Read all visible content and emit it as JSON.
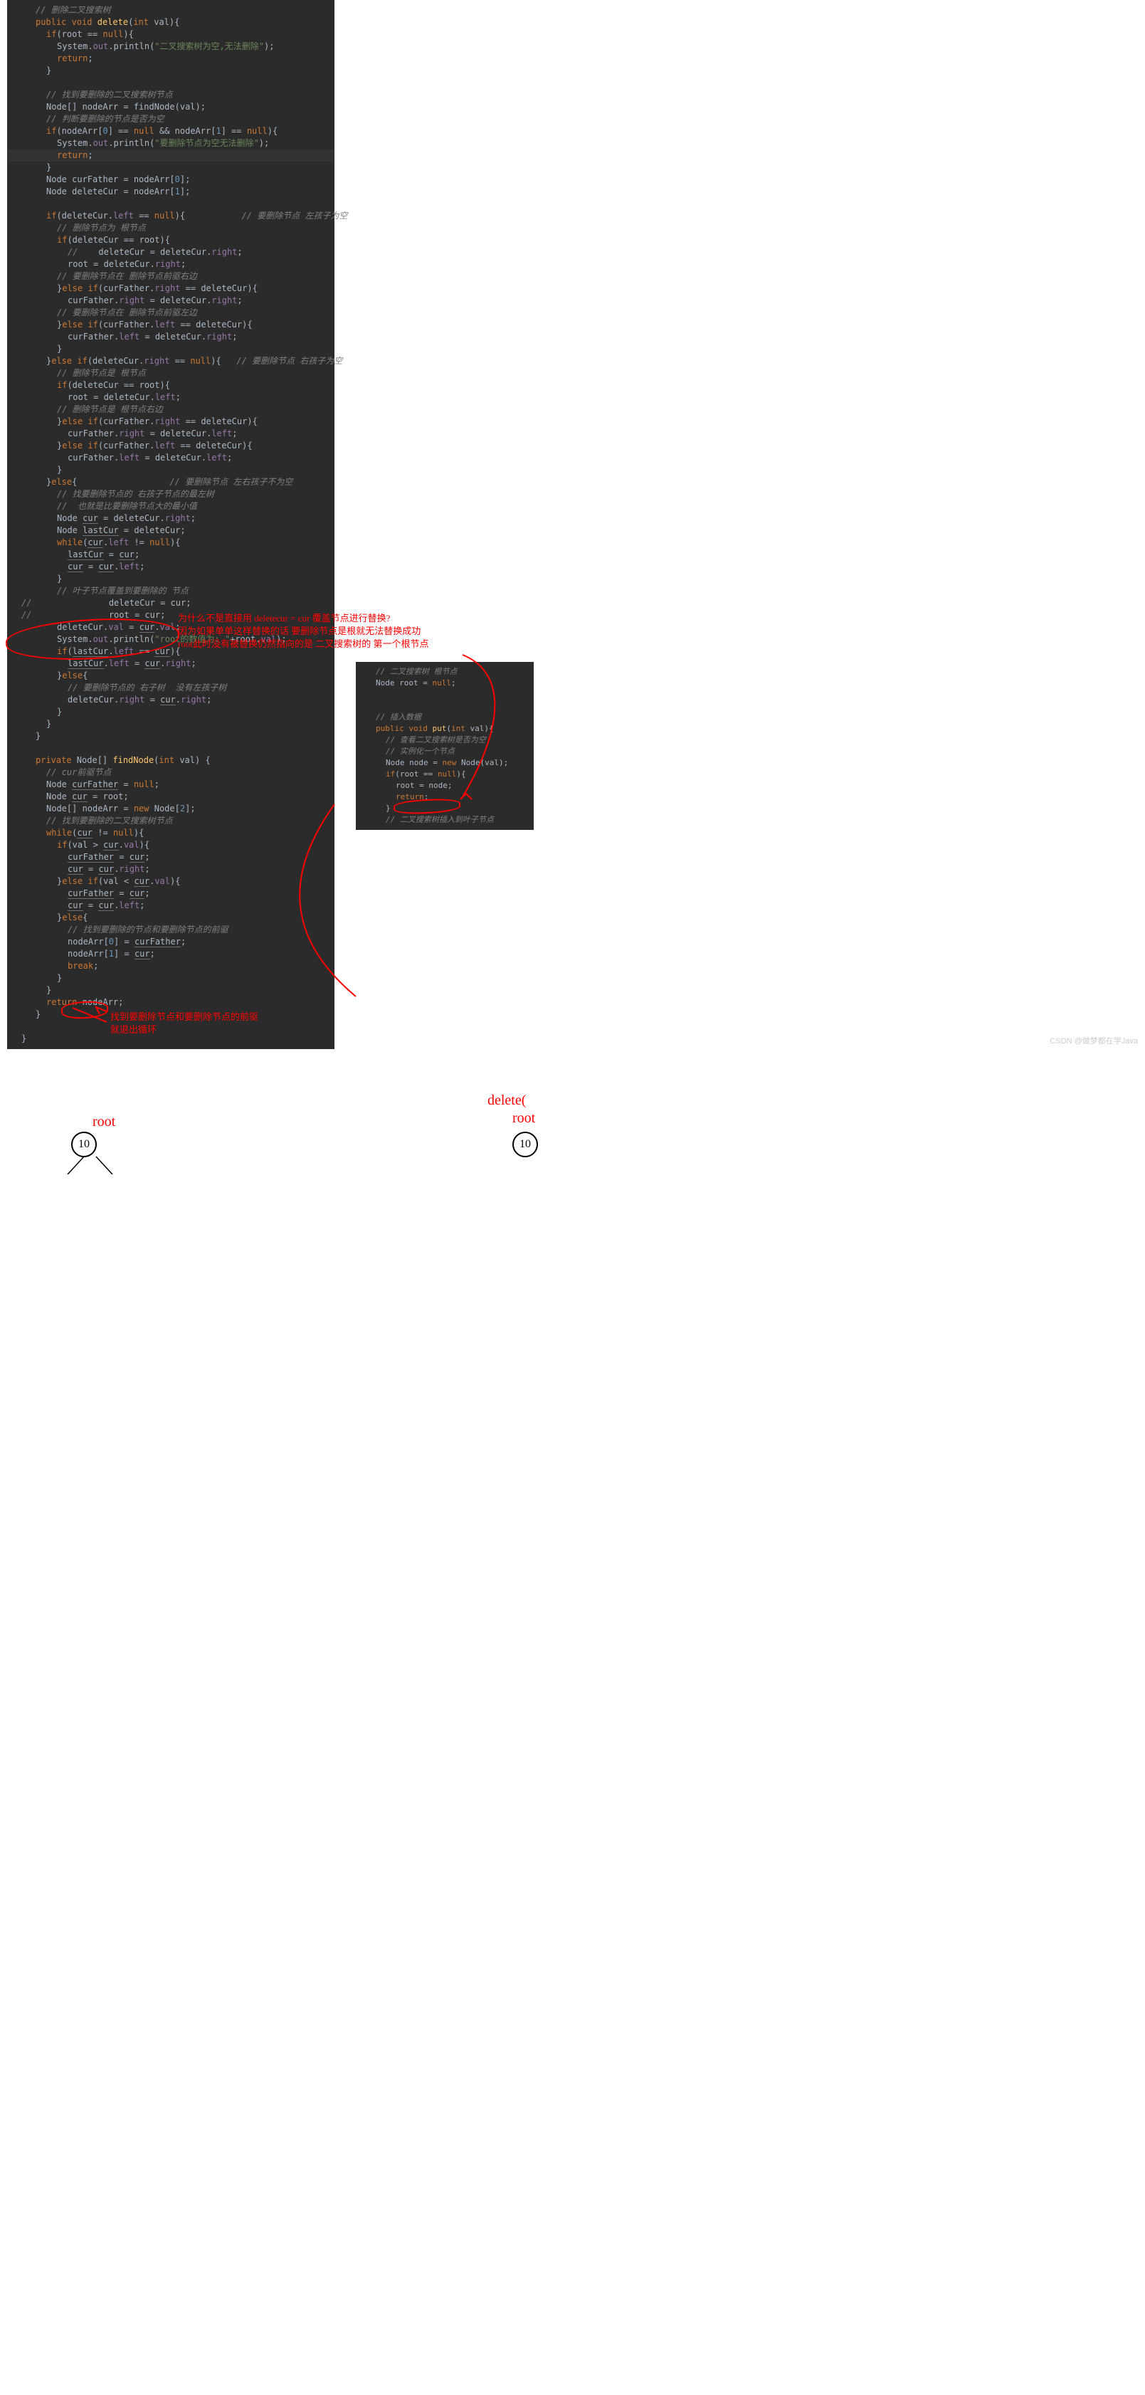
{
  "main": {
    "c0": "// 删除二叉搜索树",
    "l1a": "public void",
    "l1b": "delete",
    "l1c": "(",
    "l1d": "int",
    "l1e": " val){",
    "l2a": "if",
    "l2b": "(root == ",
    "l2c": "null",
    "l2d": "){",
    "l3a": "System.",
    "l3b": "out",
    "l3c": ".println(",
    "l3d": "\"二叉搜索树为空,无法删除\"",
    "l3e": ");",
    "l4a": "return",
    "l4b": ";",
    "l5": "}",
    "blank": "",
    "c1": "// 找到要删除的二叉搜索树节点",
    "l6a": "Node[] nodeArr = findNode(val);",
    "c2": "// 判断要删除的节点是否为空",
    "l7a": "if",
    "l7b": "(nodeArr[",
    "l7c": "0",
    "l7d": "] == ",
    "l7e": "null",
    "l7f": " && nodeArr[",
    "l7g": "1",
    "l7h": "] == ",
    "l7i": "null",
    "l7j": "){",
    "l8a": "System.",
    "l8b": "out",
    "l8c": ".println(",
    "l8d": "\"要删除节点为空无法删除\"",
    "l8e": ");",
    "l9a": "return",
    "l9b": ";",
    "l10": "}",
    "l11a": "Node curFather = nodeArr[",
    "l11b": "0",
    "l11c": "];",
    "l12a": "Node deleteCur = nodeArr[",
    "l12b": "1",
    "l12c": "];",
    "l13a": "if",
    "l13b": "(deleteCur.",
    "l13c": "left",
    "l13d": " == ",
    "l13e": "null",
    "l13f": "){",
    "l13g": "           // 要删除节点 左孩子为空",
    "c3": "// 删除节点为 根节点",
    "l14a": "if",
    "l14b": "(deleteCur == root){",
    "l15a": "    deleteCur = deleteCur.",
    "l15b": "right",
    "l15c": ";",
    "l16a": "root = deleteCur.",
    "l16b": "right",
    "l16c": ";",
    "c4": "// 要删除节点在 删除节点前驱右边",
    "l17a": "}",
    "l17b": "else if",
    "l17c": "(curFather.",
    "l17d": "right",
    "l17e": " == deleteCur){",
    "l18a": "curFather.",
    "l18b": "right",
    "l18c": " = deleteCur.",
    "l18d": "right",
    "l18e": ";",
    "c5": "// 要删除节点在 删除节点前驱左边",
    "l19a": "}",
    "l19b": "else if",
    "l19c": "(curFather.",
    "l19d": "left",
    "l19e": " == deleteCur){",
    "l20a": "curFather.",
    "l20b": "left",
    "l20c": " = deleteCur.",
    "l20d": "right",
    "l20e": ";",
    "l21": "}",
    "l22a": "}",
    "l22b": "else if",
    "l22c": "(deleteCur.",
    "l22d": "right",
    "l22e": " == ",
    "l22f": "null",
    "l22g": "){",
    "l22h": "   // 要删除节点 右孩子为空",
    "c6": "// 删除节点是 根节点",
    "l23a": "if",
    "l23b": "(deleteCur == root){",
    "l24a": "root = deleteCur.",
    "l24b": "left",
    "l24c": ";",
    "c7": "// 删除节点是 根节点右边",
    "l25a": "}",
    "l25b": "else if",
    "l25c": "(curFather.",
    "l25d": "right",
    "l25e": " == deleteCur){",
    "l26a": "curFather.",
    "l26b": "right",
    "l26c": " = deleteCur.",
    "l26d": "left",
    "l26e": ";",
    "l27a": "}",
    "l27b": "else if",
    "l27c": "(curFather.",
    "l27d": "left",
    "l27e": " == deleteCur){",
    "l28a": "curFather.",
    "l28b": "left",
    "l28c": " = deleteCur.",
    "l28d": "left",
    "l28e": ";",
    "l29": "}",
    "l30a": "}",
    "l30b": "else",
    "l30c": "{",
    "l30d": "                  // 要删除节点 左右孩子不为空",
    "c8": "// 找要删除节点的 右孩子节点的最左树",
    "c9": "//  也就是比要删除节点大的最小值",
    "l31a": "Node ",
    "l31b": "cur",
    "l31c": " = deleteCur.",
    "l31d": "right",
    "l31e": ";",
    "l32a": "Node ",
    "l32b": "lastCur",
    "l32c": " = deleteCur;",
    "l33a": "while",
    "l33b": "(",
    "l33c": "cur",
    "l33d": ".",
    "l33e": "left",
    "l33f": " != ",
    "l33g": "null",
    "l33h": "){",
    "l34a": "lastCur",
    "l34b": " = ",
    "l34c": "cur",
    "l34d": ";",
    "l35a": "cur",
    "l35b": " = ",
    "l35c": "cur",
    "l35d": ".",
    "l35e": "left",
    "l35f": ";",
    "l36": "}",
    "c10": "// 叶子节点覆盖到要删除的 节点",
    "l37": "deleteCur = cur;",
    "l38": "root = cur;",
    "l39a": "deleteCur.",
    "l39b": "val",
    "l39c": " = ",
    "l39d": "cur",
    "l39e": ".",
    "l39f": "val",
    "l39g": ";",
    "l40a": "System.",
    "l40b": "out",
    "l40c": ".println(",
    "l40d": "\"root的数值为: \"",
    "l40e": "+root.",
    "l40f": "val",
    "l40g": ");",
    "l41a": "if",
    "l41b": "(",
    "l41c": "lastCur",
    "l41d": ".",
    "l41e": "left",
    "l41f": " == ",
    "l41g": "cur",
    "l41h": "){",
    "l42a": "lastCur",
    "l42b": ".",
    "l42c": "left",
    "l42d": " = ",
    "l42e": "cur",
    "l42f": ".",
    "l42g": "right",
    "l42h": ";",
    "l43a": "}",
    "l43b": "else",
    "l43c": "{",
    "c11": "// 要删除节点的 右子树  没有左孩子树",
    "l44a": "deleteCur.",
    "l44b": "right",
    "l44c": " = ",
    "l44d": "cur",
    "l44e": ".",
    "l44f": "right",
    "l44g": ";",
    "l45": "}",
    "l46": "}",
    "l47": "}",
    "l48a": "private",
    "l48b": " Node[] ",
    "l48c": "findNode",
    "l48d": "(",
    "l48e": "int",
    "l48f": " val) {",
    "c12": "// cur前驱节点",
    "l49a": "Node ",
    "l49b": "curFather",
    "l49c": " = ",
    "l49d": "null",
    "l49e": ";",
    "l50a": "Node ",
    "l50b": "cur",
    "l50c": " = root;",
    "l51a": "Node[] nodeArr = ",
    "l51b": "new ",
    "l51c": "Node[",
    "l51d": "2",
    "l51e": "];",
    "c13": "// 找到要删除的二叉搜索树节点",
    "l52a": "while",
    "l52b": "(",
    "l52c": "cur",
    "l52d": " != ",
    "l52e": "null",
    "l52f": "){",
    "l53a": "if",
    "l53b": "(val > ",
    "l53c": "cur",
    "l53d": ".",
    "l53e": "val",
    "l53f": "){",
    "l54a": "curFather",
    "l54b": " = ",
    "l54c": "cur",
    "l54d": ";",
    "l55a": "cur",
    "l55b": " = ",
    "l55c": "cur",
    "l55d": ".",
    "l55e": "right",
    "l55f": ";",
    "l56a": "}",
    "l56b": "else if",
    "l56c": "(val < ",
    "l56d": "cur",
    "l56e": ".",
    "l56f": "val",
    "l56g": "){",
    "l57a": "curFather",
    "l57b": " = ",
    "l57c": "cur",
    "l57d": ";",
    "l58a": "cur",
    "l58b": " = ",
    "l58c": "cur",
    "l58d": ".",
    "l58e": "left",
    "l58f": ";",
    "l59a": "}",
    "l59b": "else",
    "l59c": "{",
    "c14": "// 找到要删除的节点和要删除节点的前驱",
    "l60a": "nodeArr[",
    "l60b": "0",
    "l60c": "] = ",
    "l60d": "curFather",
    "l60e": ";",
    "l61a": "nodeArr[",
    "l61b": "1",
    "l61c": "] = ",
    "l61d": "cur",
    "l61e": ";",
    "l62a": "break",
    "l62b": ";",
    "l63": "}",
    "l64": "}",
    "l65a": "return",
    "l65b": " nodeArr;",
    "l66": "}",
    "cc1": "//",
    "cc2": "//"
  },
  "side": {
    "c0": "// 二叉搜索树 根节点",
    "l1a": "Node root = ",
    "l1b": "null",
    "l1c": ";",
    "c1": "// 插入数据",
    "l2a": "public void ",
    "l2b": "put",
    "l2c": "(",
    "l2d": "int",
    "l2e": " val){",
    "c2": "// 查看二叉搜索树是否为空",
    "c3": "// 实例化一个节点",
    "l3a": "Node node = ",
    "l3b": "new ",
    "l3c": "Node(val);",
    "l4a": "if",
    "l4b": "(root == ",
    "l4c": "null",
    "l4d": "){",
    "l5": "root = node;",
    "l6a": "return",
    "l6b": ";",
    "l7": "}",
    "c4": "// 二叉搜索树插入到叶子节点"
  },
  "annotations": {
    "a1_l1": "为什么不是直接用 deletecur = cur 覆盖节点进行替换?",
    "a1_l2": "因为如果单单这样替换的话  要删除节点是根就无法替换成功",
    "a1_l3": "root此时没有被替换仍然指向的是  二叉搜索树的 第一个根节点",
    "a2_l1": "找到要删除节点和要删除节点的前驱",
    "a2_l2": "就退出循环",
    "root": "root",
    "delete": "delete(",
    "node": "10"
  },
  "watermark": "CSDN @做梦都在学Java"
}
